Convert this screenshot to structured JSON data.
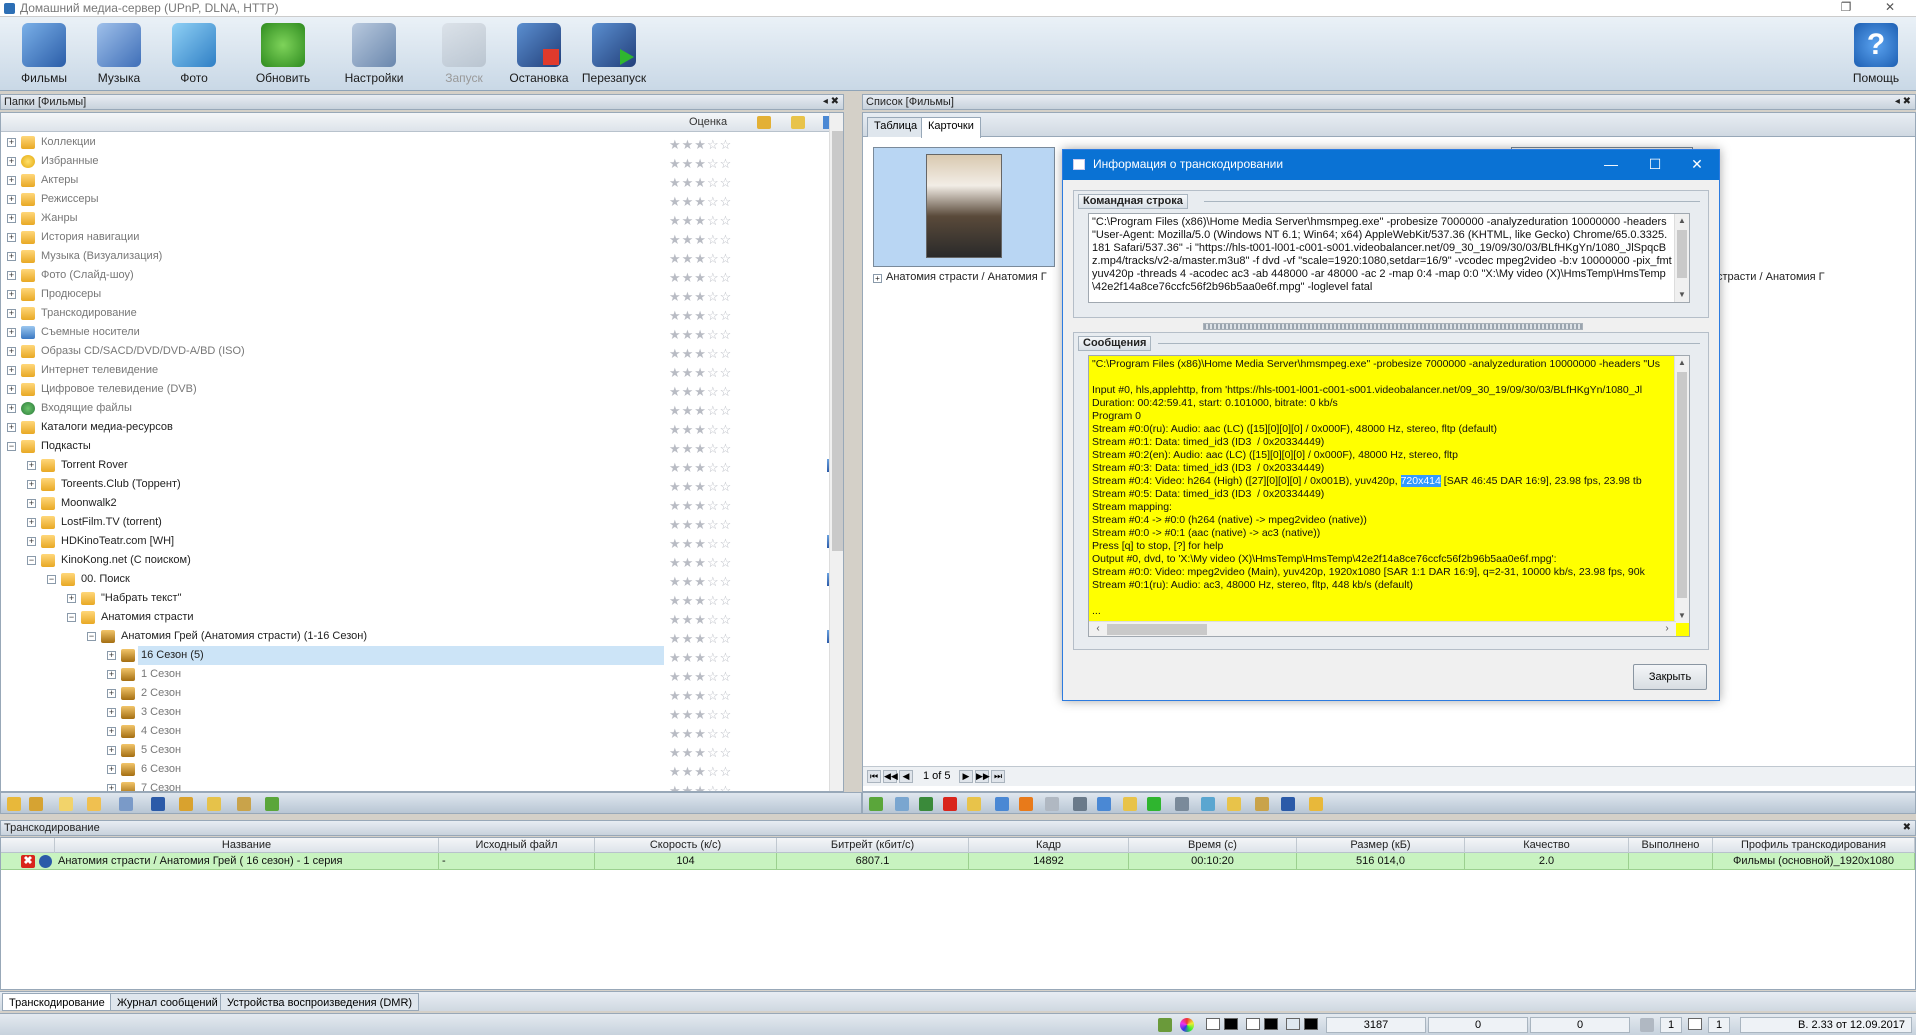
{
  "window": {
    "title": "Домашний медиа-сервер (UPnP, DLNA, HTTP)",
    "restore_glyph": "❐",
    "close_glyph": "✕"
  },
  "toolbar": {
    "buttons": [
      {
        "label": "Фильмы",
        "icon": "films-icon"
      },
      {
        "label": "Музыка",
        "icon": "music-icon"
      },
      {
        "label": "Фото",
        "icon": "photo-icon"
      },
      {
        "label": "Обновить",
        "icon": "refresh-icon"
      },
      {
        "label": "Настройки",
        "icon": "settings-icon"
      },
      {
        "label": "Запуск",
        "icon": "start-icon",
        "disabled": true
      },
      {
        "label": "Остановка",
        "icon": "stop-icon"
      },
      {
        "label": "Перезапуск",
        "icon": "restart-icon"
      }
    ],
    "help_label": "Помощь",
    "help_glyph": "?"
  },
  "left_panel": {
    "header": "Папки [Фильмы]",
    "pin": "◂ ✖",
    "rating_column": "Оценка",
    "rows": [
      {
        "label": "Коллекции",
        "level": 0,
        "icon": "folder",
        "dim": true
      },
      {
        "label": "Избранные",
        "level": 0,
        "icon": "star",
        "dim": true
      },
      {
        "label": "Актеры",
        "level": 0,
        "icon": "folder",
        "dim": true
      },
      {
        "label": "Режиссеры",
        "level": 0,
        "icon": "folder",
        "dim": true
      },
      {
        "label": "Жанры",
        "level": 0,
        "icon": "folder",
        "dim": true
      },
      {
        "label": "История навигации",
        "level": 0,
        "icon": "folder",
        "dim": true
      },
      {
        "label": "Музыка (Визуализация)",
        "level": 0,
        "icon": "folder",
        "dim": true
      },
      {
        "label": "Фото (Слайд-шоу)",
        "level": 0,
        "icon": "folder",
        "dim": true
      },
      {
        "label": "Продюсеры",
        "level": 0,
        "icon": "folder",
        "dim": true
      },
      {
        "label": "Транскодирование",
        "level": 0,
        "icon": "folder",
        "dim": true
      },
      {
        "label": "Съемные носители",
        "level": 0,
        "icon": "blue",
        "dim": true
      },
      {
        "label": "Образы CD/SACD/DVD/DVD-A/BD (ISO)",
        "level": 0,
        "icon": "folder",
        "dim": true
      },
      {
        "label": "Интернет телевидение",
        "level": 0,
        "icon": "folder",
        "dim": true
      },
      {
        "label": "Цифровое телевидение (DVB)",
        "level": 0,
        "icon": "folder",
        "dim": true
      },
      {
        "label": "Входящие файлы",
        "level": 0,
        "icon": "globe",
        "dim": true
      },
      {
        "label": "Каталоги медиа-ресурсов",
        "level": 0,
        "icon": "folder"
      },
      {
        "label": "Подкасты",
        "level": 0,
        "icon": "folder",
        "expanded": true
      },
      {
        "label": "Torrent Rover",
        "level": 1,
        "icon": "folder",
        "mark": true
      },
      {
        "label": "Toreents.Club (Торрент)",
        "level": 1,
        "icon": "folder"
      },
      {
        "label": "Moonwalk2",
        "level": 1,
        "icon": "folder"
      },
      {
        "label": "LostFilm.TV (torrent)",
        "level": 1,
        "icon": "folder"
      },
      {
        "label": "HDKinoTeatr.com [WH]",
        "level": 1,
        "icon": "folder",
        "mark": true
      },
      {
        "label": "KinoKong.net (С поиском)",
        "level": 1,
        "icon": "folder",
        "expanded": true
      },
      {
        "label": "00. Поиск",
        "level": 2,
        "icon": "folder",
        "expanded": true,
        "mark": true
      },
      {
        "label": "\"Набрать текст\"",
        "level": 3,
        "icon": "folder"
      },
      {
        "label": "Анатомия страсти",
        "level": 3,
        "icon": "folder",
        "expanded": true
      },
      {
        "label": "Анатомия Грей (Анатомия страсти) (1-16 Сезон)",
        "level": 4,
        "icon": "box",
        "expanded": true,
        "mark": true
      },
      {
        "label": "16 Сезон  (5)",
        "level": 5,
        "icon": "box",
        "selected": true
      },
      {
        "label": "1 Сезон",
        "level": 5,
        "icon": "box",
        "dim": true
      },
      {
        "label": "2 Сезон",
        "level": 5,
        "icon": "box",
        "dim": true
      },
      {
        "label": "3 Сезон",
        "level": 5,
        "icon": "box",
        "dim": true
      },
      {
        "label": "4 Сезон",
        "level": 5,
        "icon": "box",
        "dim": true
      },
      {
        "label": "5 Сезон",
        "level": 5,
        "icon": "box",
        "dim": true
      },
      {
        "label": "6 Сезон",
        "level": 5,
        "icon": "box",
        "dim": true
      },
      {
        "label": "7 Сезон",
        "level": 5,
        "icon": "box",
        "dim": true
      }
    ],
    "stars": "★★★☆☆"
  },
  "right_panel": {
    "header": "Список [Фильмы]",
    "pin": "◂ ✖",
    "tabs": [
      "Таблица",
      "Карточки"
    ],
    "active_tab": 1,
    "cards": [
      {
        "caption": "Анатомия страсти / Анатомия Г",
        "selected": true
      },
      {
        "caption": "страсти / Анатомия Г",
        "selected": false
      }
    ],
    "pager_text": "1 of 5",
    "pager_glyphs": [
      "⏮",
      "◀◀",
      "◀",
      "▶",
      "▶▶",
      "⏭"
    ]
  },
  "dialog": {
    "title": "Информация о транскодировании",
    "min_glyph": "—",
    "max_glyph": "☐",
    "close_glyph": "✕",
    "cmd_group": "Командная строка",
    "cmd_text": "\"C:\\Program Files (x86)\\Home Media Server\\hmsmpeg.exe\" -probesize 7000000 -analyzeduration 10000000 -headers \"User-Agent: Mozilla/5.0 (Windows NT 6.1; Win64; x64) AppleWebKit/537.36 (KHTML, like Gecko) Chrome/65.0.3325.181 Safari/537.36\" -i \"https://hls-t001-l001-c001-s001.videobalancer.net/09_30_19/09/30/03/BLfHKgYn/1080_JlSpqcBz.mp4/tracks/v2-a/master.m3u8\" -f dvd -vf \"scale=1920:1080,setdar=16/9\" -vcodec mpeg2video -b:v 10000000 -pix_fmt yuv420p -threads 4 -acodec ac3 -ab 448000 -ar 48000 -ac 2 -map 0:4 -map 0:0 \"X:\\My video (X)\\HmsTemp\\HmsTemp\\42e2f14a8ce76ccfc56f2b96b5aa0e6f.mpg\" -loglevel fatal",
    "msg_group": "Сообщения",
    "messages": [
      "\"C:\\Program Files (x86)\\Home Media Server\\hmsmpeg.exe\" -probesize 7000000 -analyzeduration 10000000 -headers \"Us",
      "",
      "Input #0, hls,applehttp, from 'https://hls-t001-l001-c001-s001.videobalancer.net/09_30_19/09/30/03/BLfHKgYn/1080_Jl",
      "Duration: 00:42:59.41, start: 0.101000, bitrate: 0 kb/s",
      "Program 0",
      "Stream #0:0(ru): Audio: aac (LC) ([15][0][0][0] / 0x000F), 48000 Hz, stereo, fltp (default)",
      "Stream #0:1: Data: timed_id3 (ID3  / 0x20334449)",
      "Stream #0:2(en): Audio: aac (LC) ([15][0][0][0] / 0x000F), 48000 Hz, stereo, fltp",
      "Stream #0:3: Data: timed_id3 (ID3  / 0x20334449)",
      "Stream #0:4: Video: h264 (High) ([27][0][0][0] / 0x001B), yuv420p, |720x414| [SAR 46:45 DAR 16:9], 23.98 fps, 23.98 tb",
      "Stream #0:5: Data: timed_id3 (ID3  / 0x20334449)",
      "Stream mapping:",
      "Stream #0:4 -> #0:0 (h264 (native) -> mpeg2video (native))",
      "Stream #0:0 -> #0:1 (aac (native) -> ac3 (native))",
      "Press [q] to stop, [?] for help",
      "Output #0, dvd, to 'X:\\My video (X)\\HmsTemp\\HmsTemp\\42e2f14a8ce76ccfc56f2b96b5aa0e6f.mpg':",
      "Stream #0:0: Video: mpeg2video (Main), yuv420p, 1920x1080 [SAR 1:1 DAR 16:9], q=2-31, 10000 kb/s, 23.98 fps, 90k",
      "Stream #0:1(ru): Audio: ac3, 48000 Hz, stereo, fltp, 448 kb/s (default)",
      "",
      "..."
    ],
    "close_button": "Закрыть"
  },
  "transcoding": {
    "header": "Транскодирование",
    "pin": "✖",
    "columns": [
      "Название",
      "Исходный файл",
      "Скорость (к/с)",
      "Битрейт (кбит/с)",
      "Кадр",
      "Время (с)",
      "Размер (кБ)",
      "Качество",
      "Выполнено",
      "Профиль транскодирования"
    ],
    "row": {
      "name": "Анатомия страсти / Анатомия Грей ( 16 сезон) - 1 серия",
      "source": "-",
      "speed": "104",
      "bitrate": "6807.1",
      "frame": "14892",
      "time": "00:10:20",
      "size": "516 014,0",
      "quality": "2.0",
      "done": "",
      "profile": "Фильмы (основной)_1920x1080"
    },
    "cancel_glyph": "✖"
  },
  "bottom_tabs": [
    "Транскодирование",
    "Журнал сообщений",
    "Устройства воспроизведения (DMR)"
  ],
  "status": {
    "count1": "3187",
    "count2": "0",
    "count3": "0",
    "pages1": "1",
    "pages2": "1",
    "version": "В. 2.33 от 12.09.2017"
  }
}
